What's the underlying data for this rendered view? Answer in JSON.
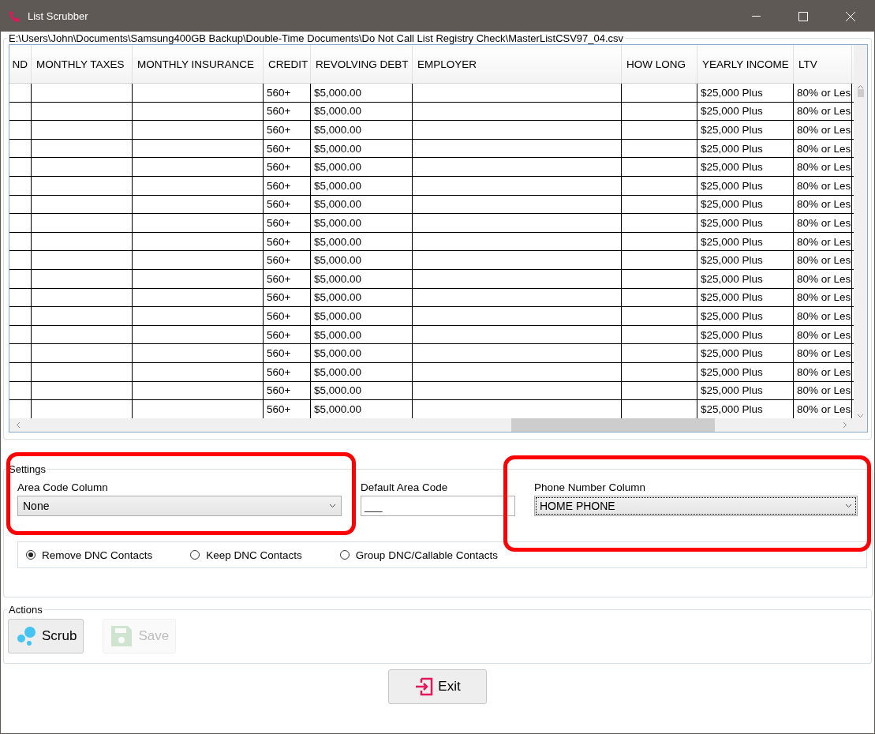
{
  "window": {
    "title": "List Scrubber"
  },
  "file_path": "E:\\Users\\John\\Documents\\Samsung400GB Backup\\Double-Time Documents\\Do Not Call List Registry Check\\MasterListCSV97_04.csv",
  "table": {
    "columns": [
      {
        "label": "ND"
      },
      {
        "label": "MONTHLY TAXES"
      },
      {
        "label": "MONTHLY INSURANCE"
      },
      {
        "label": "CREDIT"
      },
      {
        "label": "REVOLVING DEBT"
      },
      {
        "label": "EMPLOYER"
      },
      {
        "label": "HOW  LONG"
      },
      {
        "label": "YEARLY INCOME"
      },
      {
        "label": "LTV"
      }
    ],
    "rows": [
      {
        "credit": "560+",
        "debt": "$5,000.00",
        "income": "$25,000 Plus",
        "ltv": "80% or Les"
      },
      {
        "credit": "560+",
        "debt": "$5,000.00",
        "income": "$25,000 Plus",
        "ltv": "80% or Les"
      },
      {
        "credit": "560+",
        "debt": "$5,000.00",
        "income": "$25,000 Plus",
        "ltv": "80% or Les"
      },
      {
        "credit": "560+",
        "debt": "$5,000.00",
        "income": "$25,000 Plus",
        "ltv": "80% or Les"
      },
      {
        "credit": "560+",
        "debt": "$5,000.00",
        "income": "$25,000 Plus",
        "ltv": "80% or Les"
      },
      {
        "credit": "560+",
        "debt": "$5,000.00",
        "income": "$25,000 Plus",
        "ltv": "80% or Les"
      },
      {
        "credit": "560+",
        "debt": "$5,000.00",
        "income": "$25,000 Plus",
        "ltv": "80% or Les"
      },
      {
        "credit": "560+",
        "debt": "$5,000.00",
        "income": "$25,000 Plus",
        "ltv": "80% or Les"
      },
      {
        "credit": "560+",
        "debt": "$5,000.00",
        "income": "$25,000 Plus",
        "ltv": "80% or Les"
      },
      {
        "credit": "560+",
        "debt": "$5,000.00",
        "income": "$25,000 Plus",
        "ltv": "80% or Les"
      },
      {
        "credit": "560+",
        "debt": "$5,000.00",
        "income": "$25,000 Plus",
        "ltv": "80% or Les"
      },
      {
        "credit": "560+",
        "debt": "$5,000.00",
        "income": "$25,000 Plus",
        "ltv": "80% or Les"
      },
      {
        "credit": "560+",
        "debt": "$5,000.00",
        "income": "$25,000 Plus",
        "ltv": "80% or Les"
      },
      {
        "credit": "560+",
        "debt": "$5,000.00",
        "income": "$25,000 Plus",
        "ltv": "80% or Les"
      },
      {
        "credit": "560+",
        "debt": "$5,000.00",
        "income": "$25,000 Plus",
        "ltv": "80% or Les"
      },
      {
        "credit": "560+",
        "debt": "$5,000.00",
        "income": "$25,000 Plus",
        "ltv": "80% or Les"
      },
      {
        "credit": "560+",
        "debt": "$5,000.00",
        "income": "$25,000 Plus",
        "ltv": "80% or Les"
      },
      {
        "credit": "560+",
        "debt": "$5,000.00",
        "income": "$25,000 Plus",
        "ltv": "80% or Les"
      }
    ]
  },
  "settings": {
    "title": "Settings",
    "area_code_column": {
      "label": "Area Code Column",
      "value": "None",
      "focused": false,
      "highlighted": true
    },
    "default_area_code": {
      "label": "Default Area Code",
      "value": "___"
    },
    "phone_number_column": {
      "label": "Phone Number Column",
      "value": "HOME PHONE",
      "focused": true,
      "highlighted": true
    },
    "options": [
      {
        "label": "Remove DNC Contacts",
        "selected": true
      },
      {
        "label": "Keep DNC Contacts",
        "selected": false
      },
      {
        "label": "Group DNC/Callable Contacts",
        "selected": false
      }
    ]
  },
  "actions": {
    "title": "Actions",
    "buttons": [
      {
        "kind": "scrub",
        "label": "Scrub",
        "disabled": false
      },
      {
        "kind": "save",
        "label": "Save",
        "disabled": true
      }
    ]
  },
  "exit_button": {
    "label": "Exit"
  }
}
